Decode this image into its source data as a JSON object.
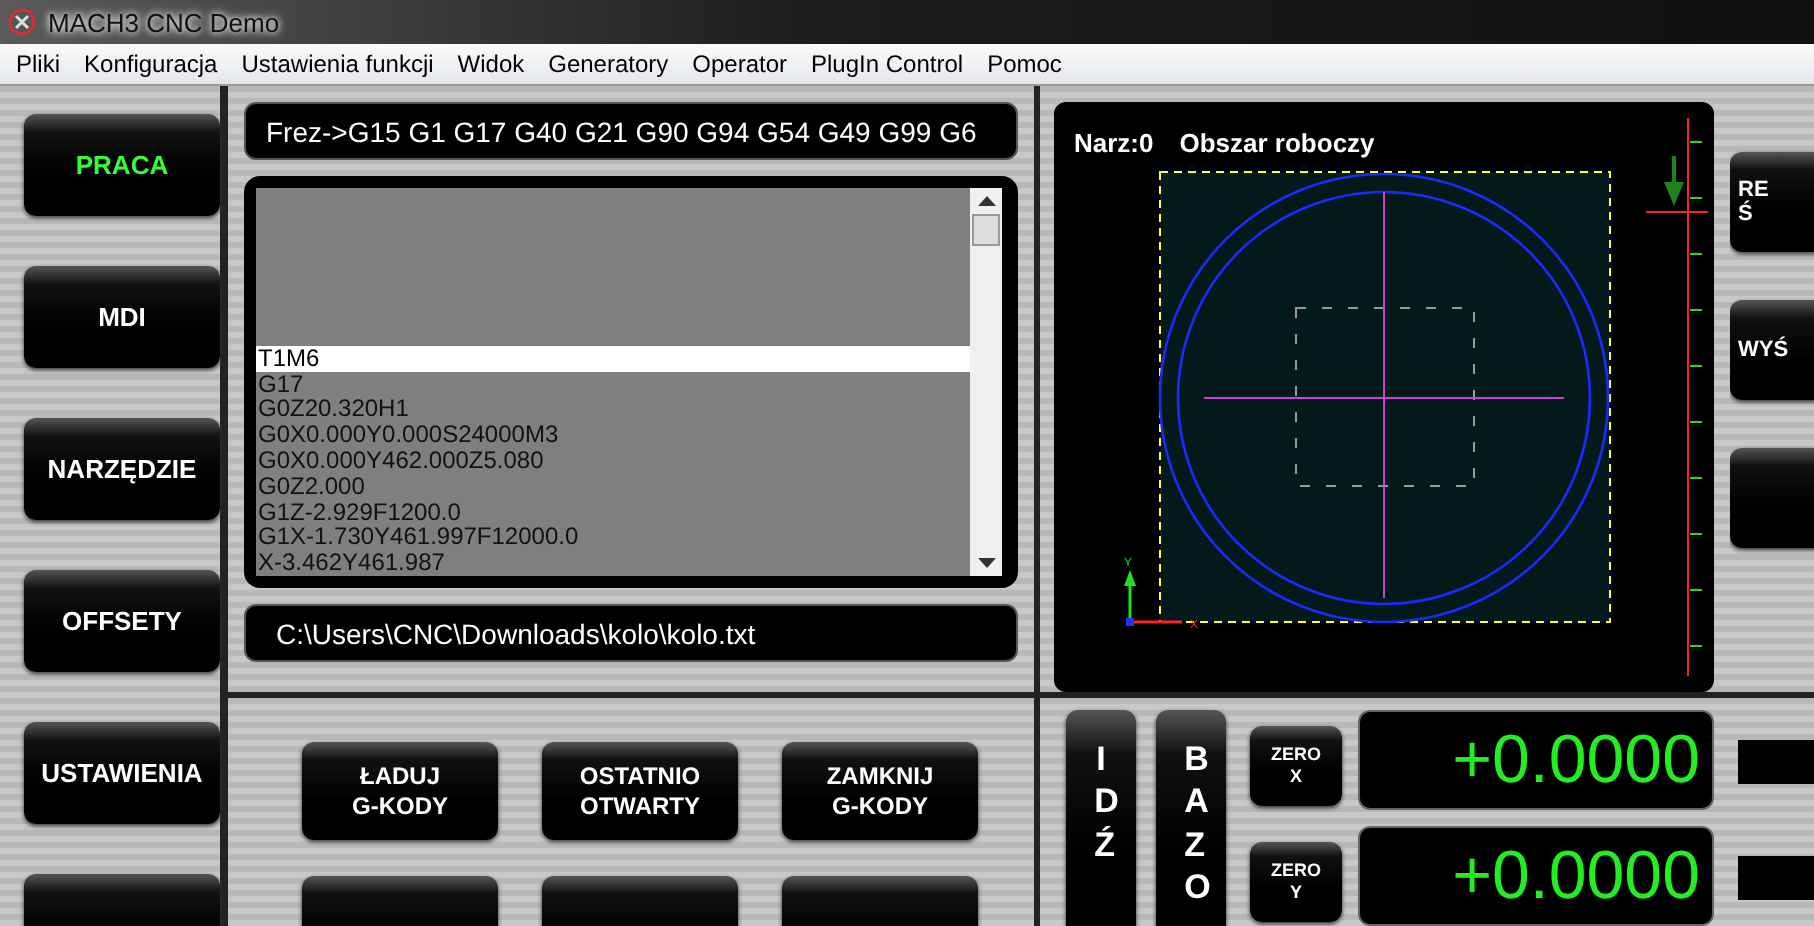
{
  "window": {
    "title": "MACH3 CNC  Demo"
  },
  "menu": [
    "Pliki",
    "Konfiguracja",
    "Ustawienia funkcji",
    "Widok",
    "Generatory",
    "Operator",
    "PlugIn Control",
    "Pomoc"
  ],
  "nav_buttons": [
    {
      "label": "PRACA",
      "selected": true
    },
    {
      "label": "MDI",
      "selected": false
    },
    {
      "label": "NARZĘDZIE",
      "selected": false
    },
    {
      "label": "OFFSETY",
      "selected": false
    },
    {
      "label": "USTAWIENIA",
      "selected": false
    }
  ],
  "modal_line": "Frez->G15  G1 G17 G40 G21 G90 G94 G54 G49 G99 G6",
  "gcode_lines": [
    {
      "text": "T1M6",
      "selected": true
    },
    {
      "text": "G17",
      "selected": false
    },
    {
      "text": "G0Z20.320H1",
      "selected": false
    },
    {
      "text": "G0X0.000Y0.000S24000M3",
      "selected": false
    },
    {
      "text": "G0X0.000Y462.000Z5.080",
      "selected": false
    },
    {
      "text": "G0Z2.000",
      "selected": false
    },
    {
      "text": "G1Z-2.929F1200.0",
      "selected": false
    },
    {
      "text": "G1X-1.730Y461.997F12000.0",
      "selected": false
    },
    {
      "text": "X-3.462Y461.987",
      "selected": false
    }
  ],
  "file_path": "C:\\Users\\CNC\\Downloads\\kolo\\kolo.txt",
  "toolpath": {
    "tool": "Narz:0",
    "title": "Obszar roboczy",
    "axis_y": "Y",
    "axis_x": "X"
  },
  "right_buttons": [
    {
      "lines": [
        "RE",
        "Ś"
      ]
    },
    {
      "lines": [
        "WYŚ"
      ]
    }
  ],
  "file_buttons": [
    {
      "lines": [
        "ŁADUJ",
        "G-KODY"
      ]
    },
    {
      "lines": [
        "OSTATNIO",
        "OTWARTY"
      ]
    },
    {
      "lines": [
        "ZAMKNIJ",
        "G-KODY"
      ]
    }
  ],
  "vertical_buttons": [
    "IDŹ",
    "BAZO"
  ],
  "dro": [
    {
      "zero": [
        "ZERO",
        "X"
      ],
      "value": "+0.0000"
    },
    {
      "zero": [
        "ZERO",
        "Y"
      ],
      "value": "+0.0000"
    }
  ]
}
